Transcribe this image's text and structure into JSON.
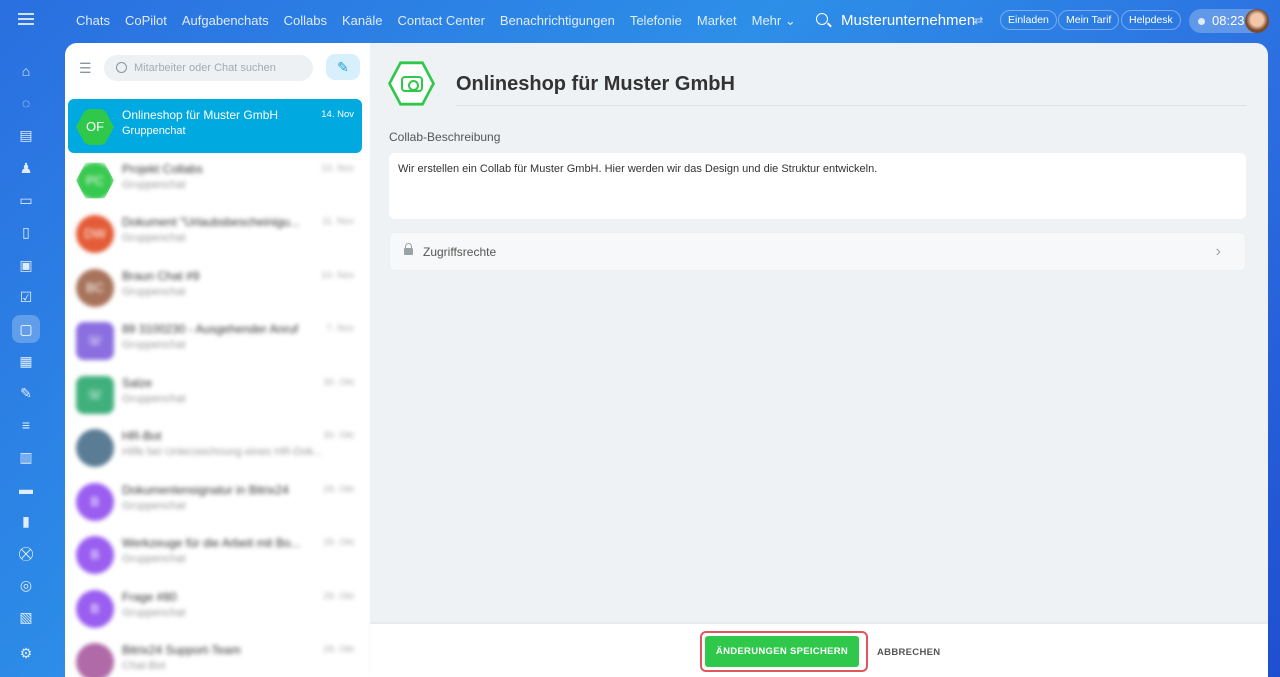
{
  "topbar": {
    "nav": [
      "Chats",
      "CoPilot",
      "Aufgabenchats",
      "Collabs",
      "Kanäle",
      "Contact Center",
      "Benachrichtigungen",
      "Telefonie",
      "Market",
      "Mehr ⌄"
    ],
    "company": "Musterunternehmen",
    "invite": "Einladen",
    "tariff": "Mein Tarif",
    "helpdesk": "Helpdesk",
    "time": "08:23"
  },
  "sidebar": [
    "home-icon",
    "copilot-icon",
    "feed-icon",
    "contacts-icon",
    "inbox-icon",
    "document-icon",
    "board-icon",
    "tasks-icon",
    "chat-icon",
    "calendar-icon",
    "sign-icon",
    "filter-icon",
    "storage-icon",
    "card-icon",
    "analytics-icon",
    "shop-icon",
    "goal-icon",
    "box-icon",
    "settings-icon"
  ],
  "chatlist": {
    "search_placeholder": "Mitarbeiter oder Chat suchen",
    "items": [
      {
        "initials": "OF",
        "name": "Onlineshop für Muster GmbH",
        "sub": "Gruppenchat",
        "date": "14. Nov",
        "color": "#2fc84a"
      },
      {
        "initials": "PC",
        "name": "Projekt Collabs",
        "sub": "Gruppenchat",
        "date": "13. Nov",
        "color": "#37c94f"
      },
      {
        "initials": "DW",
        "name": "Dokument \"Urlaubsbescheinigu...",
        "sub": "Gruppenchat",
        "date": "11. Nov",
        "color": "#e45b37"
      },
      {
        "initials": "BC",
        "name": "Braun Chat #9",
        "sub": "Gruppenchat",
        "date": "10. Nov",
        "color": "#a8735b"
      },
      {
        "initials": "☏",
        "name": "89 3100230 - Ausgehender Anruf",
        "sub": "Gruppenchat",
        "date": "7. Nov",
        "color": "#8b6ee0"
      },
      {
        "initials": "☏",
        "name": "Salze",
        "sub": "Gruppenchat",
        "date": "30. Okt",
        "color": "#3fb07c"
      },
      {
        "initials": "",
        "name": "HR-Bot",
        "sub": "Hilfe bei Unterzeichnung eines HR-Dok...",
        "date": "30. Okt",
        "color": "#5a7d95"
      },
      {
        "initials": "B",
        "name": "Dokumentensignatur in Bitrix24",
        "sub": "Gruppenchat",
        "date": "29. Okt",
        "color": "#9a5ef0"
      },
      {
        "initials": "B",
        "name": "Werkzeuge für die Arbeit mit Bo...",
        "sub": "Gruppenchat",
        "date": "29. Okt",
        "color": "#9a5ef0"
      },
      {
        "initials": "B",
        "name": "Frage #80",
        "sub": "Gruppenchat",
        "date": "29. Okt",
        "color": "#9a5ef0"
      },
      {
        "initials": "",
        "name": "Bitrix24 Support-Team",
        "sub": "Chat-Bot",
        "date": "29. Okt",
        "color": "#b06aa8"
      }
    ]
  },
  "main": {
    "title": "Onlineshop für Muster GmbH",
    "desc_label": "Collab-Beschreibung",
    "description": "Wir erstellen ein Collab für Muster GmbH. Hier werden wir das Design und die Struktur entwickeln.",
    "access": "Zugriffsrechte",
    "save": "ÄNDERUNGEN SPEICHERN",
    "cancel": "ABBRECHEN"
  }
}
